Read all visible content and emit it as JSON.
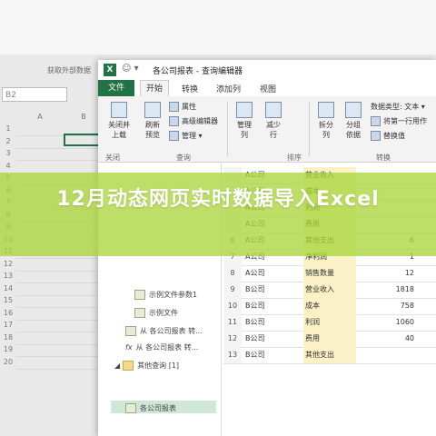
{
  "excel": {
    "ribbon_label": "获取外部数据",
    "name_box": "B2",
    "columns": [
      "A",
      "B"
    ],
    "rows": [
      "1",
      "2",
      "3",
      "4",
      "5",
      "6",
      "7",
      "8",
      "9",
      "10",
      "11",
      "12",
      "13",
      "14",
      "15",
      "16",
      "17",
      "18",
      "19",
      "20"
    ]
  },
  "editor": {
    "app_letter": "X",
    "title": "各公司报表 - 查询编辑器",
    "tabs": {
      "file": "文件",
      "home": "开始",
      "transform": "转换",
      "add_column": "添加列",
      "view": "视图"
    },
    "ribbon": {
      "close_load": "关闭并\n上载",
      "refresh_preview": "刷新\n预览",
      "properties": "属性",
      "advanced_editor": "高级编辑器",
      "manage": "管理",
      "manage_cols": "管理\n列",
      "reduce_rows": "减少\n行",
      "split_col": "拆分\n列",
      "group_by": "分组\n依据",
      "data_type": "数据类型: 文本",
      "first_row_header": "将第一行用作",
      "replace_values": "替换值",
      "group_sort": "排序",
      "group_transform": "转换",
      "group_close": "关闭",
      "group_query": "查询",
      "close_load_short": "关闭并上载"
    },
    "queries": [
      {
        "label": "示例文件参数1"
      },
      {
        "label": "示例文件"
      },
      {
        "label": "从 各公司报表 转..."
      },
      {
        "label": "从 各公司报表 转..."
      },
      {
        "label": "其他查询 [1]"
      },
      {
        "label": "各公司报表"
      }
    ],
    "table_rows": [
      {
        "idx": "",
        "co": "A公司",
        "item": "营业收入",
        "val": ""
      },
      {
        "idx": "",
        "co": "A公司",
        "item": "成本",
        "val": ""
      },
      {
        "idx": "",
        "co": "A公司",
        "item": "利润",
        "val": ""
      },
      {
        "idx": "",
        "co": "A公司",
        "item": "费用",
        "val": ""
      },
      {
        "idx": "6",
        "co": "A公司",
        "item": "其他支出",
        "val": "6"
      },
      {
        "idx": "7",
        "co": "A公司",
        "item": "净利润",
        "val": "1"
      },
      {
        "idx": "8",
        "co": "A公司",
        "item": "销售数量",
        "val": "12"
      },
      {
        "idx": "9",
        "co": "B公司",
        "item": "营业收入",
        "val": "1818"
      },
      {
        "idx": "10",
        "co": "B公司",
        "item": "成本",
        "val": "758"
      },
      {
        "idx": "11",
        "co": "B公司",
        "item": "利润",
        "val": "1060"
      },
      {
        "idx": "12",
        "co": "B公司",
        "item": "费用",
        "val": "40"
      },
      {
        "idx": "13",
        "co": "B公司",
        "item": "其他支出",
        "val": ""
      }
    ]
  },
  "banner": {
    "title": "12月动态网页实时数据导入Excel"
  },
  "colors": {
    "excel_green": "#217346",
    "banner": "#aad63c"
  }
}
